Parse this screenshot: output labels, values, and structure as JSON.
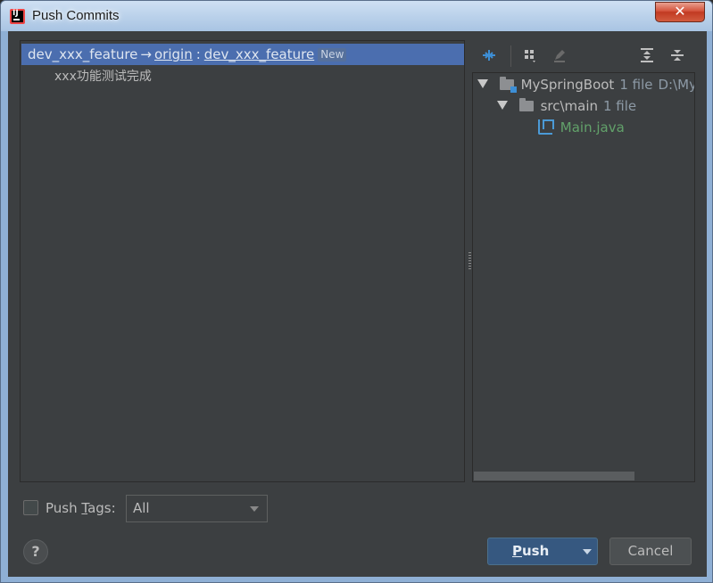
{
  "window": {
    "title": "Push Commits",
    "close_label": "✕"
  },
  "commits": {
    "branch": {
      "local": "dev_xxx_feature",
      "arrow": "→",
      "remote": "origin",
      "separator": ":",
      "target": "dev_xxx_feature",
      "badge": "New"
    },
    "items": [
      {
        "message": "xxx功能测试完成"
      }
    ]
  },
  "toolbar": {
    "icons": [
      "collapse-arrows-icon",
      "group-by-icon",
      "edit-icon",
      "expand-all-icon",
      "collapse-all-icon"
    ]
  },
  "files": {
    "root": {
      "name": "MySpringBoot",
      "count": "1 file",
      "path": "D:\\My"
    },
    "folder": {
      "name": "src\\main",
      "count": "1 file"
    },
    "file": {
      "name": "Main.java"
    }
  },
  "bottom": {
    "push_tags_pre": "Push ",
    "push_tags_mnemonic": "T",
    "push_tags_post": "ags:",
    "tags_select_value": "All",
    "help_label": "?",
    "push_mnemonic": "P",
    "push_rest": "ush",
    "cancel_label": "Cancel"
  },
  "colors": {
    "selection": "#4b6eaf",
    "file_modified": "#62a16a",
    "background": "#3c3f41"
  }
}
